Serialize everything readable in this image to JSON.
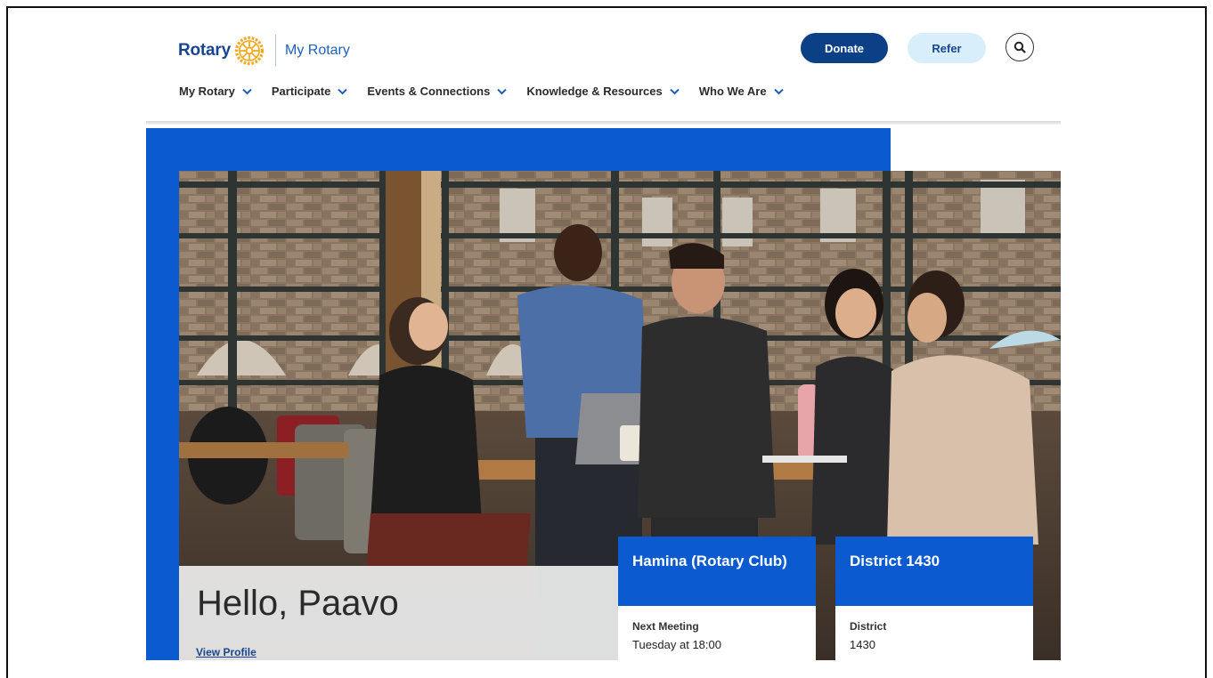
{
  "header": {
    "logo_word": "Rotary",
    "logo_sub": "My Rotary",
    "donate_label": "Donate",
    "refer_label": "Refer"
  },
  "nav": {
    "items": [
      {
        "label": "My Rotary"
      },
      {
        "label": "Participate"
      },
      {
        "label": "Events & Connections"
      },
      {
        "label": "Knowledge & Resources"
      },
      {
        "label": "Who We Are"
      }
    ]
  },
  "hero": {
    "greeting": "Hello, Paavo",
    "view_profile": "View Profile"
  },
  "cards": [
    {
      "title": "Hamina (Rotary Club)",
      "label": "Next Meeting",
      "value": "Tuesday at 18:00"
    },
    {
      "title": "District 1430",
      "label": "District",
      "value": "1430"
    }
  ],
  "colors": {
    "brand_blue": "#0c5ad0",
    "navy": "#0b3f86",
    "gold": "#f7a81b",
    "refer_bg": "#d8eefb"
  },
  "icons": {
    "search": "search-icon",
    "chevron": "chevron-down-icon",
    "wheel": "rotary-wheel-icon"
  }
}
